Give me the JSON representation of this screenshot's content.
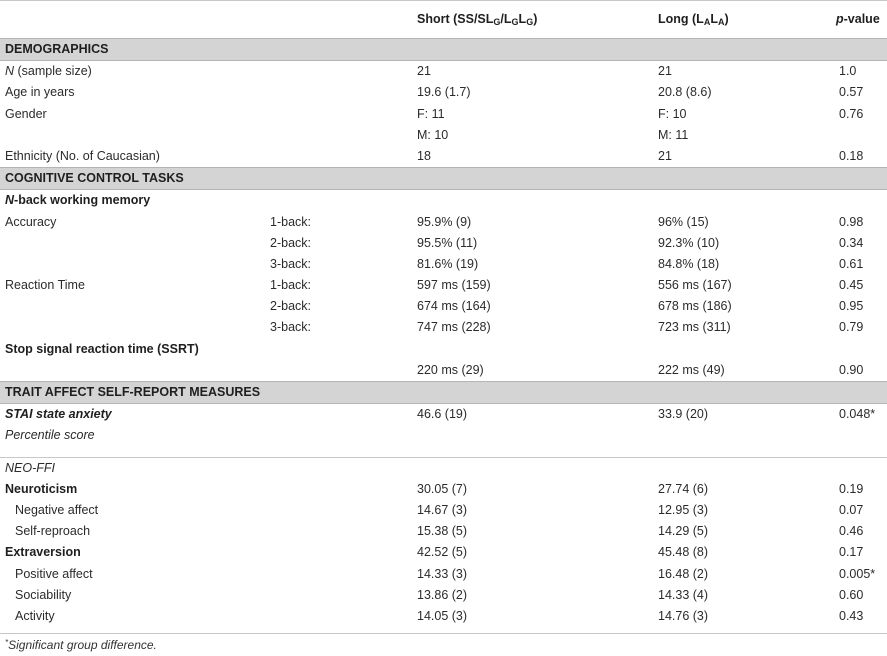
{
  "header": {
    "col_short_prefix": "Short (SS/SL",
    "col_short_mid": "/L",
    "col_short_suffix": ")",
    "sub_g": "G",
    "col_long_prefix": "Long (L",
    "col_long_suffix": ")",
    "sub_a": "A",
    "col_p_italic": "p",
    "col_p_rest": "-value"
  },
  "sections": {
    "demographics": "DEMOGRAPHICS",
    "cognitive": "COGNITIVE CONTROL TASKS",
    "trait": "TRAIT AFFECT SELF-REPORT MEASURES"
  },
  "demographics": {
    "n_label_italic": "N",
    "n_label_rest": " (sample size)",
    "n_short": "21",
    "n_long": "21",
    "n_p": "1.0",
    "age_label": "Age in years",
    "age_short": "19.6 (1.7)",
    "age_long": "20.8 (8.6)",
    "age_p": "0.57",
    "gender_label": "Gender",
    "gender_short_f": "F: 11",
    "gender_long_f": "F: 10",
    "gender_p": "0.76",
    "gender_short_m": "M: 10",
    "gender_long_m": "M: 11",
    "eth_label": "Ethnicity (No. of Caucasian)",
    "eth_short": "18",
    "eth_long": "21",
    "eth_p": "0.18"
  },
  "nback": {
    "title_italic": "N",
    "title_rest": "-back working memory",
    "acc_label": "Accuracy",
    "rt_label": "Reaction Time",
    "acc_rows": [
      {
        "level": "1-back:",
        "short": "95.9% (9)",
        "long": "96% (15)",
        "p": "0.98"
      },
      {
        "level": "2-back:",
        "short": "95.5% (11)",
        "long": "92.3% (10)",
        "p": "0.34"
      },
      {
        "level": "3-back:",
        "short": "81.6% (19)",
        "long": "84.8% (18)",
        "p": "0.61"
      }
    ],
    "rt_rows": [
      {
        "level": "1-back:",
        "short": "597 ms (159)",
        "long": "556 ms (167)",
        "p": "0.45"
      },
      {
        "level": "2-back:",
        "short": "674 ms (164)",
        "long": "678 ms (186)",
        "p": "0.95"
      },
      {
        "level": "3-back:",
        "short": "747 ms (228)",
        "long": "723 ms (311)",
        "p": "0.79"
      }
    ]
  },
  "ssrt": {
    "title": "Stop signal reaction time (SSRT)",
    "short": "220 ms (29)",
    "long": "222 ms (49)",
    "p": "0.90"
  },
  "trait": {
    "stai_label": "STAI state anxiety",
    "stai_short": "46.6 (19)",
    "stai_long": "33.9 (20)",
    "stai_p": "0.048*",
    "percentile_label": "Percentile score",
    "neo_label": "NEO-FFI",
    "neuro_label": "Neuroticism",
    "neuro_short": "30.05 (7)",
    "neuro_long": "27.74 (6)",
    "neuro_p": "0.19",
    "neg_label": "Negative affect",
    "neg_short": "14.67 (3)",
    "neg_long": "12.95 (3)",
    "neg_p": "0.07",
    "selfr_label": "Self-reproach",
    "selfr_short": "15.38 (5)",
    "selfr_long": "14.29 (5)",
    "selfr_p": "0.46",
    "extra_label": "Extraversion",
    "extra_short": "42.52 (5)",
    "extra_long": "45.48 (8)",
    "extra_p": "0.17",
    "pos_label": "Positive affect",
    "pos_short": "14.33 (3)",
    "pos_long": "16.48 (2)",
    "pos_p": "0.005*",
    "soc_label": "Sociability",
    "soc_short": "13.86 (2)",
    "soc_long": "14.33 (4)",
    "soc_p": "0.60",
    "act_label": "Activity",
    "act_short": "14.05 (3)",
    "act_long": "14.76 (3)",
    "act_p": "0.43"
  },
  "footnote": {
    "mark": "*",
    "text": "Significant group difference."
  }
}
